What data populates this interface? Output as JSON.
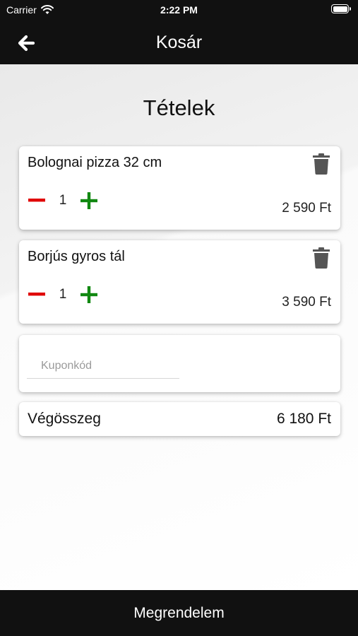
{
  "status_bar": {
    "carrier": "Carrier",
    "time": "2:22 PM"
  },
  "header": {
    "title": "Kosár",
    "back_icon": "arrow-left-icon"
  },
  "cart": {
    "section_title": "Tételek",
    "items": [
      {
        "name": "Bolognai pizza 32 cm",
        "quantity": "1",
        "price": "2 590 Ft"
      },
      {
        "name": "Borjús gyros tál",
        "quantity": "1",
        "price": "3 590 Ft"
      }
    ],
    "coupon": {
      "placeholder": "Kuponkód",
      "value": ""
    },
    "total": {
      "label": "Végösszeg",
      "value": "6 180 Ft"
    }
  },
  "order_button": {
    "label": "Megrendelem"
  },
  "colors": {
    "minus": "#e00000",
    "plus": "#118811",
    "trash": "#555555",
    "bar_background": "#111111"
  }
}
